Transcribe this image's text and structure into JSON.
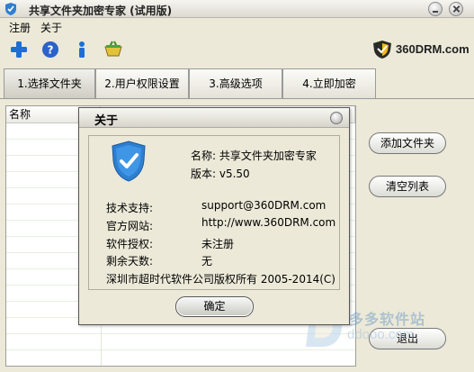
{
  "window": {
    "title": "共享文件夹加密专家 (试用版)"
  },
  "menu": {
    "items": [
      "注册",
      "关于"
    ]
  },
  "toolbar": {
    "icons": [
      "plus-icon",
      "help-icon",
      "info-icon",
      "cart-icon"
    ]
  },
  "brand": {
    "text": "360DRM.com"
  },
  "tabs": [
    {
      "label": "1.选择文件夹",
      "active": true
    },
    {
      "label": "2.用户权限设置",
      "active": false
    },
    {
      "label": "3.高级选项",
      "active": false
    },
    {
      "label": "4.立即加密",
      "active": false
    }
  ],
  "list": {
    "column_name": "名称"
  },
  "buttons": {
    "add_folder": "添加文件夹",
    "clear_list": "清空列表",
    "exit": "退出"
  },
  "about": {
    "title": "关于",
    "name_line": "名称: 共享文件夹加密专家",
    "version_line": "版本: v5.50",
    "support_label": "技术支持:",
    "support_value": "support@360DRM.com",
    "website_label": "官方网站:",
    "website_value": "http://www.360DRM.com",
    "license_label": "软件授权:",
    "license_value": "未注册",
    "days_label": "剩余天数:",
    "days_value": "无",
    "copyright": "深圳市超时代软件公司版权所有 2005-2014(C)",
    "ok": "确定"
  },
  "watermark": {
    "text": "多多软件站",
    "sub": "ddooo.com"
  },
  "colors": {
    "shield": "#2f7fd0",
    "plus": "#1d6fd6",
    "accent": "#3a8a2a"
  }
}
